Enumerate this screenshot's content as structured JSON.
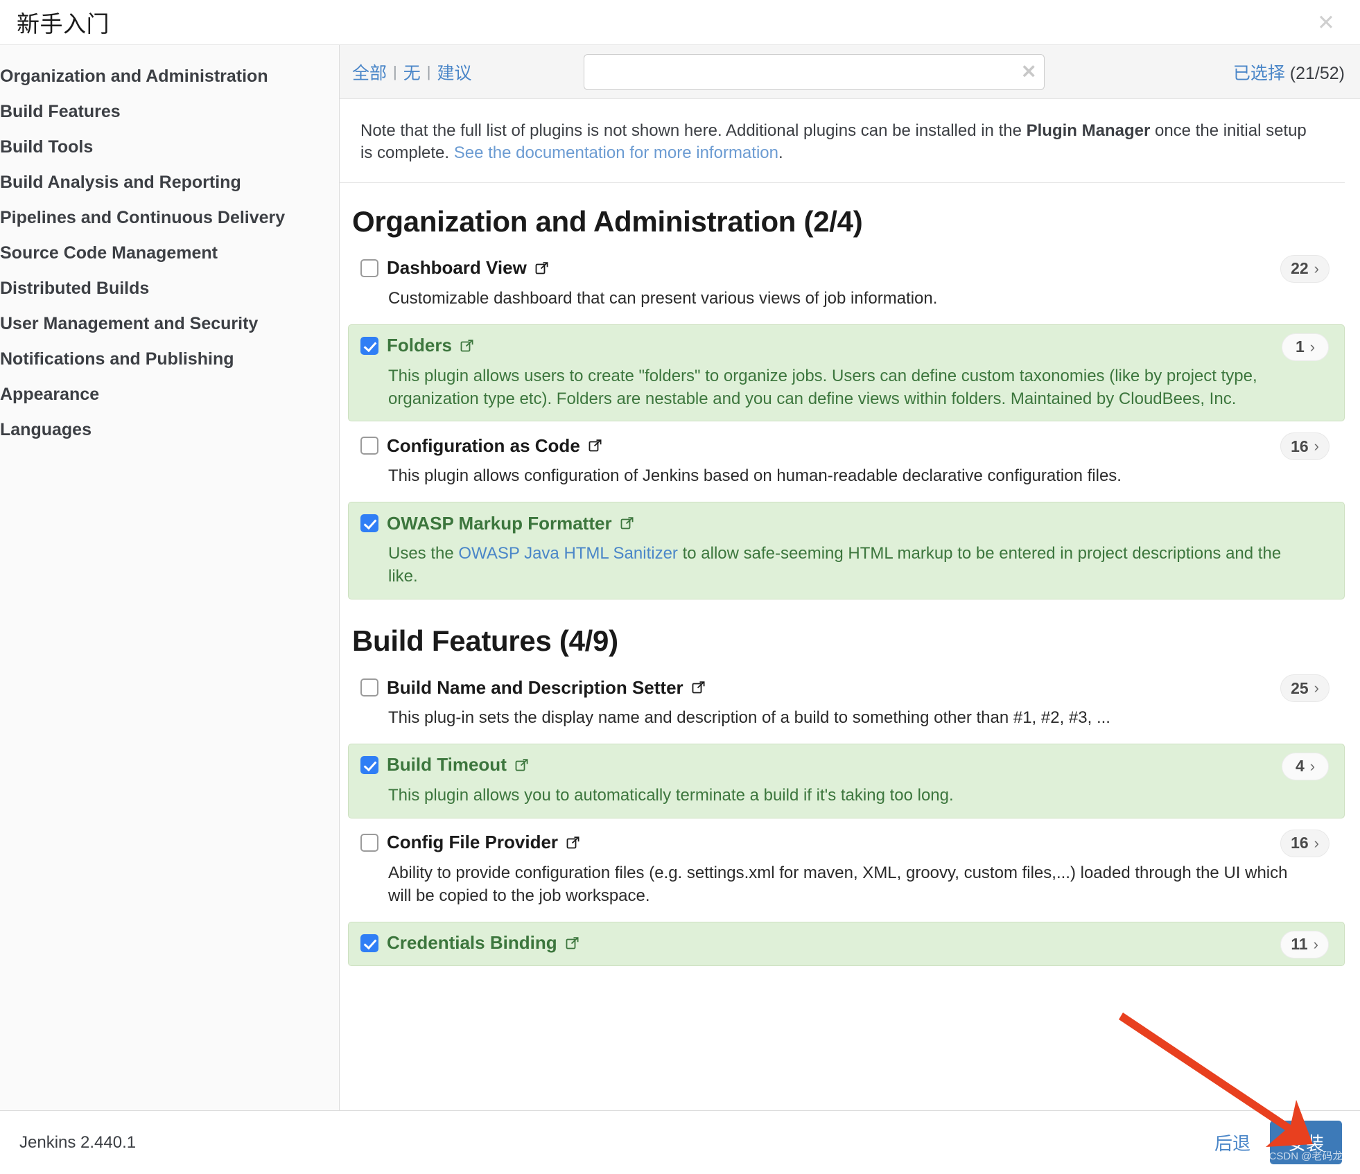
{
  "window": {
    "title": "新手入门",
    "close_icon": "close-icon"
  },
  "sidebar": {
    "items": [
      {
        "label": "Organization and Administration"
      },
      {
        "label": "Build Features"
      },
      {
        "label": "Build Tools"
      },
      {
        "label": "Build Analysis and Reporting"
      },
      {
        "label": "Pipelines and Continuous Delivery"
      },
      {
        "label": "Source Code Management"
      },
      {
        "label": "Distributed Builds"
      },
      {
        "label": "User Management and Security"
      },
      {
        "label": "Notifications and Publishing"
      },
      {
        "label": "Appearance"
      },
      {
        "label": "Languages"
      }
    ]
  },
  "toolbar": {
    "filter_all": "全部",
    "filter_none": "无",
    "filter_suggested": "建议",
    "separator": "|",
    "search_value": "",
    "search_placeholder": "",
    "clear_icon": "clear-icon",
    "selected_label": "已选择",
    "selected_count": "(21/52)"
  },
  "note": {
    "part1": "Note that the full list of plugins is not shown here. Additional plugins can be installed in the ",
    "bold": "Plugin Manager",
    "part2": " once the initial setup is complete. ",
    "link": "See the documentation for more information",
    "part3": "."
  },
  "sections": [
    {
      "title": "Organization and Administration (2/4)",
      "plugins": [
        {
          "name": "Dashboard View",
          "description": "Customizable dashboard that can present various views of job information.",
          "badge": "22",
          "selected": false
        },
        {
          "name": "Folders",
          "description": "This plugin allows users to create \"folders\" to organize jobs. Users can define custom taxonomies (like by project type, organization type etc). Folders are nestable and you can define views within folders. Maintained by CloudBees, Inc.",
          "badge": "1",
          "selected": true
        },
        {
          "name": "Configuration as Code",
          "description": "This plugin allows configuration of Jenkins based on human-readable declarative configuration files.",
          "badge": "16",
          "selected": false
        },
        {
          "name": "OWASP Markup Formatter",
          "description_pre": "Uses the ",
          "description_link": "OWASP Java HTML Sanitizer",
          "description_post": " to allow safe-seeming HTML markup to be entered in project descriptions and the like.",
          "badge": "",
          "selected": true
        }
      ]
    },
    {
      "title": "Build Features (4/9)",
      "plugins": [
        {
          "name": "Build Name and Description Setter",
          "description": "This plug-in sets the display name and description of a build to something other than #1, #2, #3, ...",
          "badge": "25",
          "selected": false
        },
        {
          "name": "Build Timeout",
          "description": "This plugin allows you to automatically terminate a build if it's taking too long.",
          "badge": "4",
          "selected": true
        },
        {
          "name": "Config File Provider",
          "description": "Ability to provide configuration files (e.g. settings.xml for maven, XML, groovy, custom files,...) loaded through the UI which will be copied to the job workspace.",
          "badge": "16",
          "selected": false
        },
        {
          "name": "Credentials Binding",
          "description": "",
          "badge": "11",
          "selected": true
        }
      ]
    }
  ],
  "footer": {
    "version": "Jenkins 2.440.1",
    "back_label": "后退",
    "install_label": "安装",
    "watermark": "CSDN @老码龙"
  },
  "colors": {
    "accent_blue": "#4a86c8",
    "primary_button": "#3d7ab8",
    "selected_row_bg": "#dff0d8",
    "selected_text": "#3c763d",
    "checkbox_blue": "#2f7ef5",
    "annotation_red": "#e8401f"
  }
}
